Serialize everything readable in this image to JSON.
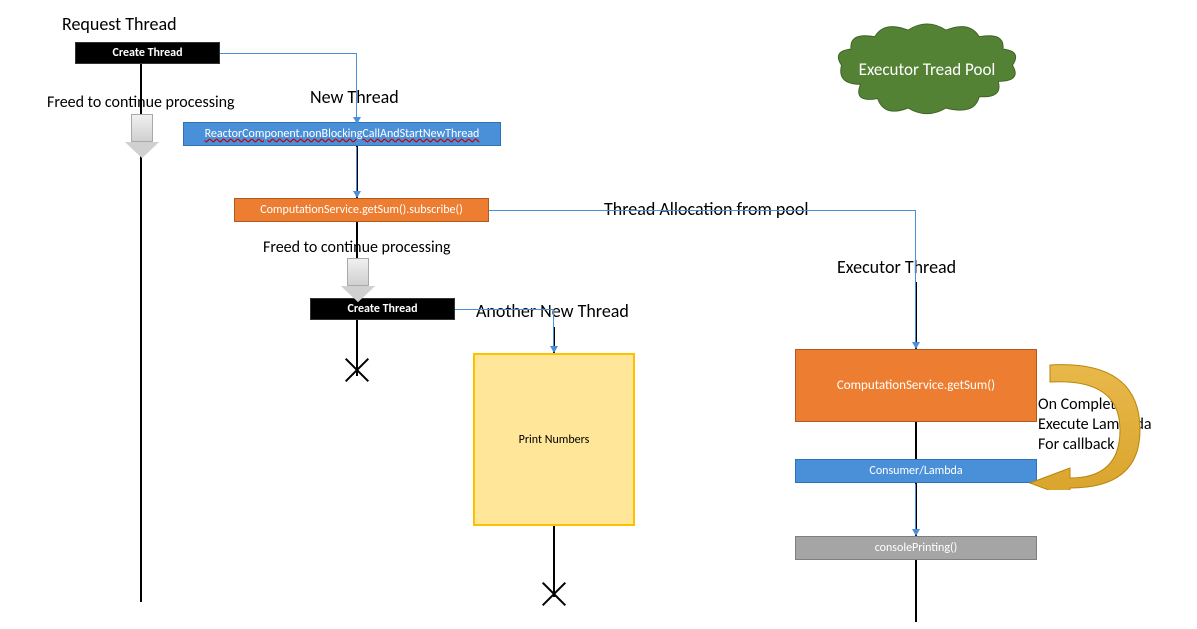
{
  "titles": {
    "requestThread": "Request Thread",
    "newThread": "New Thread",
    "anotherNewThread": "Another New Thread",
    "executorThread": "Executor Thread",
    "cloud": "Executor Tread Pool"
  },
  "boxes": {
    "createThread1": "Create Thread",
    "createThread2": "Create Thread",
    "reactorComponent": "ReactorComponent.nonBlockingCallAndStartNewThread",
    "computationSubscribe": "ComputationService.getSum().subscribe()",
    "printNumbers": "Print Numbers",
    "computationGetSum": "ComputationService.getSum()",
    "consumerLambda": "Consumer/Lambda",
    "consolePrinting": "consolePrinting()"
  },
  "annotations": {
    "freed1": "Freed to continue processing",
    "freed2": "Freed to continue processing",
    "threadAllocation": "Thread Allocation from pool",
    "onCompletion": "On Completion\nExecute Lambada\nFor callback"
  }
}
